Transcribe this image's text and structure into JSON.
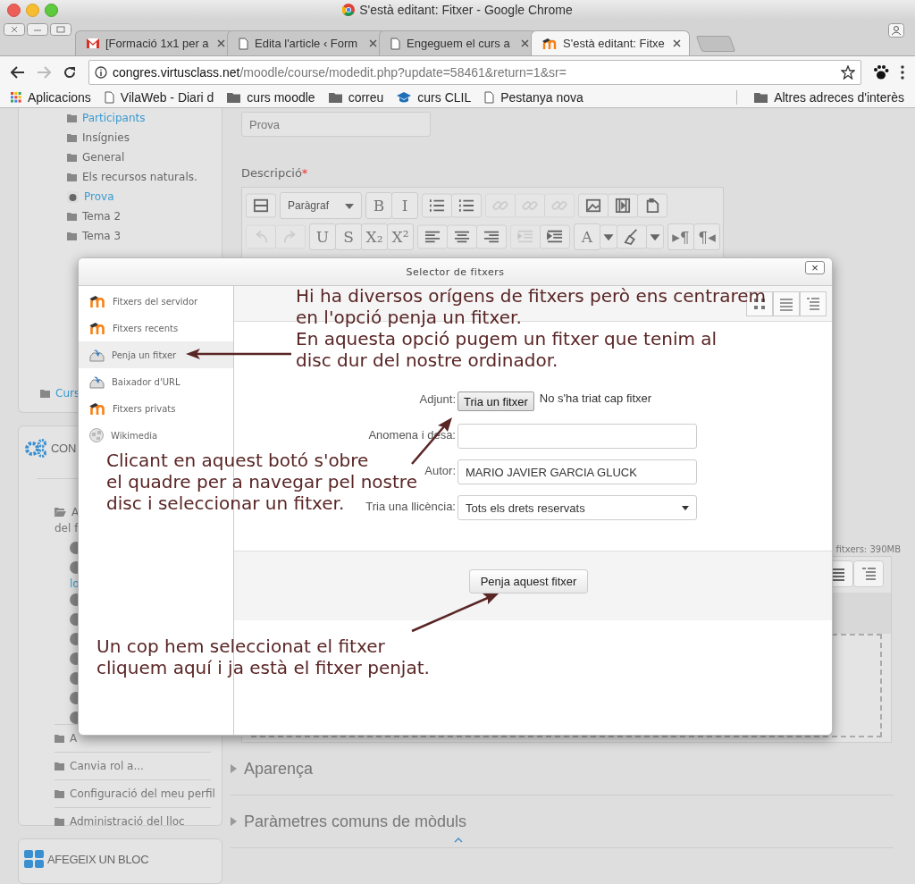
{
  "window": {
    "title": "S'està editant: Fitxer - Google Chrome"
  },
  "tabs": [
    {
      "label": "[Formació 1x1 per a",
      "kind": "mail",
      "selected": false
    },
    {
      "label": "Edita l'article ‹ Form",
      "kind": "page",
      "selected": false
    },
    {
      "label": "Engeguem el curs a",
      "kind": "page",
      "selected": false
    },
    {
      "label": "S'està editant: Fitxe",
      "kind": "moodle",
      "selected": true
    }
  ],
  "address_bar": {
    "host": "congres.virtusclass.net",
    "path": "/moodle/course/modedit.php?update=58461&return=1&sr="
  },
  "bookmarks": [
    {
      "label": "Aplicacions",
      "kind": "apps"
    },
    {
      "label": "VilaWeb - Diari d",
      "kind": "page"
    },
    {
      "label": "curs moodle",
      "kind": "folder"
    },
    {
      "label": "correu",
      "kind": "folder"
    },
    {
      "label": "curs CLIL",
      "kind": "cap"
    },
    {
      "label": "Pestanya nova",
      "kind": "page"
    }
  ],
  "other_bookmarks": "Altres adreces d'interès",
  "navigation": {
    "items": [
      {
        "label": "Participants",
        "kind": "link"
      },
      {
        "label": "Insígnies",
        "kind": "folder"
      },
      {
        "label": "General",
        "kind": "folder"
      },
      {
        "label": "Els recursos naturals.",
        "kind": "folder"
      },
      {
        "label": "Prova",
        "kind": "current"
      },
      {
        "label": "Tema 2",
        "kind": "folder"
      },
      {
        "label": "Tema 3",
        "kind": "folder"
      }
    ],
    "last_item": "Curs"
  },
  "settings": {
    "title": "CON",
    "lines": [
      "A",
      "del f"
    ],
    "link": "lo",
    "items": [
      "A",
      "Canvia rol a...",
      "Configuració del meu perfil",
      "Administració del lloc"
    ]
  },
  "add_block": {
    "title": "AFEGEIX UN BLOC"
  },
  "form": {
    "name_value": "Prova",
    "description_label": "Descripció",
    "required_mark": "*",
    "toolbar": [
      [
        [
          {
            "kind": "grid"
          }
        ],
        [
          {
            "kind": "select",
            "label": "Paràgraf"
          }
        ],
        [
          {
            "kind": "text",
            "label": "B",
            "disabled": false
          },
          {
            "kind": "text",
            "label": "I",
            "disabled": false
          }
        ],
        [
          {
            "kind": "bullets"
          },
          {
            "kind": "numbers"
          }
        ],
        [
          {
            "kind": "link",
            "disabled": true
          },
          {
            "kind": "unlink",
            "disabled": true
          },
          {
            "kind": "link",
            "disabled": true
          }
        ],
        [
          {
            "kind": "image"
          },
          {
            "kind": "media"
          },
          {
            "kind": "paste"
          }
        ]
      ],
      [
        [
          {
            "kind": "undo",
            "disabled": true
          },
          {
            "kind": "redo",
            "disabled": true
          }
        ],
        [
          {
            "kind": "text",
            "label": "U",
            "disabled": false
          },
          {
            "kind": "text",
            "label": "S",
            "disabled": false
          },
          {
            "kind": "text",
            "label": "X₂",
            "disabled": false
          },
          {
            "kind": "text",
            "label": "X²",
            "disabled": false
          }
        ],
        [
          {
            "kind": "align-left"
          },
          {
            "kind": "align-center"
          },
          {
            "kind": "align-right"
          }
        ],
        [
          {
            "kind": "outdent",
            "disabled": true
          },
          {
            "kind": "indent"
          }
        ],
        [
          {
            "kind": "text",
            "label": "A",
            "disabled": false
          },
          {
            "kind": "caret"
          },
          {
            "kind": "brush"
          },
          {
            "kind": "caret"
          }
        ],
        [
          {
            "kind": "text",
            "label": "▸¶",
            "disabled": false
          },
          {
            "kind": "text",
            "label": "¶◂",
            "disabled": false
          }
        ]
      ]
    ],
    "files_limit": "fitxers: 390MB",
    "sections": [
      "Aparença",
      "Paràmetres comuns de mòduls"
    ]
  },
  "file_picker": {
    "title": "Selector de fitxers",
    "close": "×",
    "repositories": [
      {
        "label": "Fitxers del servidor",
        "kind": "moodle",
        "selected": false
      },
      {
        "label": "Fitxers recents",
        "kind": "moodle",
        "selected": false
      },
      {
        "label": "Penja un fitxer",
        "kind": "upload",
        "selected": true
      },
      {
        "label": "Baixador d'URL",
        "kind": "upload",
        "selected": false
      },
      {
        "label": "Fitxers privats",
        "kind": "moodle",
        "selected": false
      },
      {
        "label": "Wikimedia",
        "kind": "wiki",
        "selected": false
      }
    ],
    "attachment_label": "Adjunt:",
    "choose_button": "Tria un fitxer",
    "no_file": "No s'ha triat cap fitxer",
    "save_as_label": "Anomena i desa:",
    "author_label": "Autor:",
    "author_value": "MARIO JAVIER GARCIA GLUCK",
    "license_label": "Tria una llicència:",
    "license_value": "Tots els drets reservats",
    "upload_button": "Penja aquest fitxer"
  },
  "annotations": [
    {
      "lines": [
        "Hi ha diversos orígens de fitxers però ens centrarem",
        "en l'opció penja un fitxer.",
        "En aquesta opció pugem un fitxer que tenim al",
        "disc dur del nostre ordinador."
      ]
    },
    {
      "lines": [
        "Clicant en aquest botó s'obre",
        "el quadre per a navegar pel nostre",
        "disc i seleccionar un fitxer."
      ]
    },
    {
      "lines": [
        "Un cop hem seleccionat el fitxer",
        "cliquem aquí i ja està el fitxer penjat."
      ]
    }
  ]
}
